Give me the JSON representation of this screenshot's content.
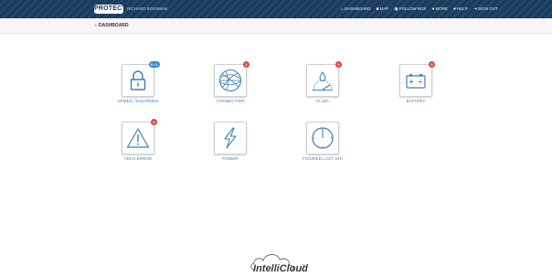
{
  "header": {
    "logo_text": "PROTECT",
    "subtitle": "RICHARD BOSSMAN",
    "nav": [
      {
        "icon": "home-icon",
        "glyph": "⌂",
        "label": "DASHBOARD"
      },
      {
        "icon": "map-icon",
        "glyph": "■",
        "label": "MAP"
      },
      {
        "icon": "follow-icon",
        "glyph": "◉",
        "label": "FOLLOW BOX"
      },
      {
        "icon": "more-icon",
        "glyph": "●",
        "label": "MORE"
      },
      {
        "icon": "help-icon",
        "glyph": "●",
        "label": "HELP"
      },
      {
        "icon": "sign-out-icon",
        "glyph": "⇥",
        "label": "SIGN OUT"
      }
    ]
  },
  "breadcrumb": {
    "icon": "home-icon",
    "label": "DASHBOARD"
  },
  "tiles": [
    {
      "label": "ARMED / DISARMED",
      "icon": "lock-icon",
      "badge": "0 / 1",
      "badge_color": "#3c8ad1"
    },
    {
      "label": "CONNECTION",
      "icon": "globe-icon",
      "badge": "1",
      "badge_color": "#e0463f"
    },
    {
      "label": "FLUID",
      "icon": "fluid-gauge-icon",
      "badge": "0",
      "badge_color": "#e0463f"
    },
    {
      "label": "BATTERY",
      "icon": "battery-icon",
      "badge": "0",
      "badge_color": "#e0463f"
    },
    {
      "label": "TECH ERROR",
      "icon": "warning-icon",
      "badge": "0",
      "badge_color": "#e0463f"
    },
    {
      "label": "POWER",
      "icon": "power-bolt-icon",
      "badge": "",
      "badge_color": ""
    },
    {
      "label": "FIGURED LAST 24H",
      "icon": "clock-icon",
      "badge": "",
      "badge_color": ""
    }
  ],
  "footer": {
    "brand": "IntelliCloud",
    "tm": "™"
  },
  "colors": {
    "header_bg": "#1a3a58",
    "icon_blue": "#3f7fb4",
    "badge_red": "#e0463f",
    "badge_blue": "#3c8ad1"
  }
}
